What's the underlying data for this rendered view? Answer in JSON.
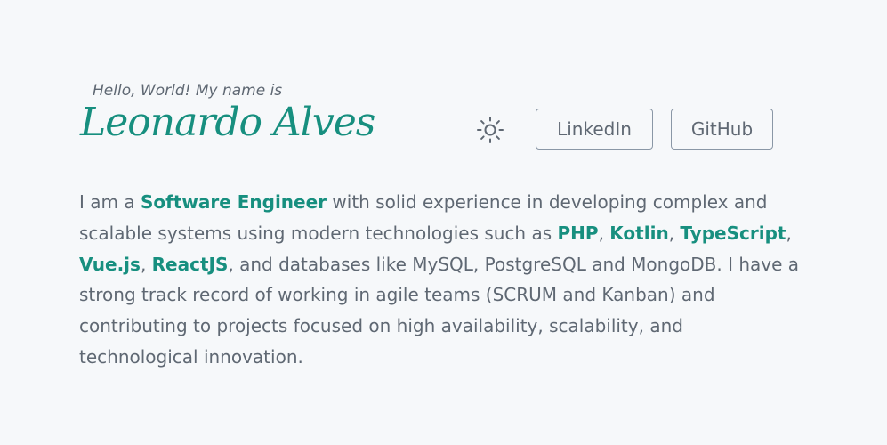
{
  "header": {
    "greeting": "Hello, World! My name is",
    "name": "Leonardo Alves"
  },
  "actions": {
    "theme_icon": "sun-icon",
    "linkedin_label": "LinkedIn",
    "github_label": "GitHub"
  },
  "bio": {
    "t0": "I am a ",
    "b0": "Software Engineer",
    "t1": " with solid experience in developing complex and scalable systems using modern technologies such as ",
    "b1": "PHP",
    "t2": ", ",
    "b2": "Kotlin",
    "t3": ", ",
    "b3": "TypeScript",
    "t4": ", ",
    "b4": "Vue.js",
    "t5": ", ",
    "b5": "ReactJS",
    "t6": ", and databases like MySQL, PostgreSQL and MongoDB. I have a strong track record of working in agile teams (SCRUM and Kanban) and contributing to projects focused on high availability, scalability, and technological innovation."
  },
  "colors": {
    "accent": "#178f7f",
    "text": "#5f6873",
    "border": "#8a97a6",
    "background": "#f6f8fa"
  }
}
